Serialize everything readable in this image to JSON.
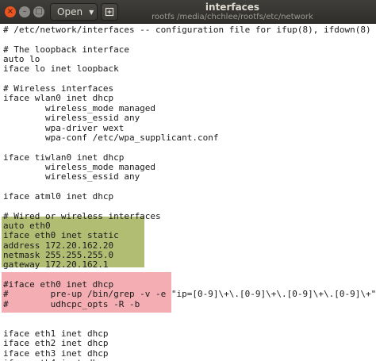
{
  "window": {
    "title": "interfaces",
    "path": "rootfs /media/chchlee/rootfs/etc/network",
    "close_glyph": "×",
    "minimize_glyph": "–",
    "maximize_glyph": "□"
  },
  "toolbar": {
    "open_label": "Open",
    "open_chevron": "▼",
    "new_document_icon": "new-document-icon"
  },
  "highlights": {
    "block1_color": "#b2bd74",
    "block2_color": "#f4adb2"
  },
  "editor": {
    "lines": [
      "# /etc/network/interfaces -- configuration file for ifup(8), ifdown(8)",
      "",
      "# The loopback interface",
      "auto lo",
      "iface lo inet loopback",
      "",
      "# Wireless interfaces",
      "iface wlan0 inet dhcp",
      "        wireless_mode managed",
      "        wireless_essid any",
      "        wpa-driver wext",
      "        wpa-conf /etc/wpa_supplicant.conf",
      "",
      "iface tiwlan0 inet dhcp",
      "        wireless_mode managed",
      "        wireless_essid any",
      "",
      "iface atml0 inet dhcp",
      "",
      "# Wired or wireless interfaces",
      "auto eth0",
      "iface eth0 inet static",
      "address 172.20.162.20",
      "netmask 255.255.255.0",
      "gateway 172.20.162.1",
      "",
      "#iface eth0 inet dhcp",
      "#        pre-up /bin/grep -v -e \"ip=[0-9]\\+\\.[0-9]\\+\\.[0-9]\\+\\.[0-9]\\+\" /",
      "#        udhcpc_opts -R -b",
      "",
      "",
      "iface eth1 inet dhcp",
      "iface eth2 inet dhcp",
      "iface eth3 inet dhcp",
      "iface eth4 inet dhcp"
    ]
  }
}
